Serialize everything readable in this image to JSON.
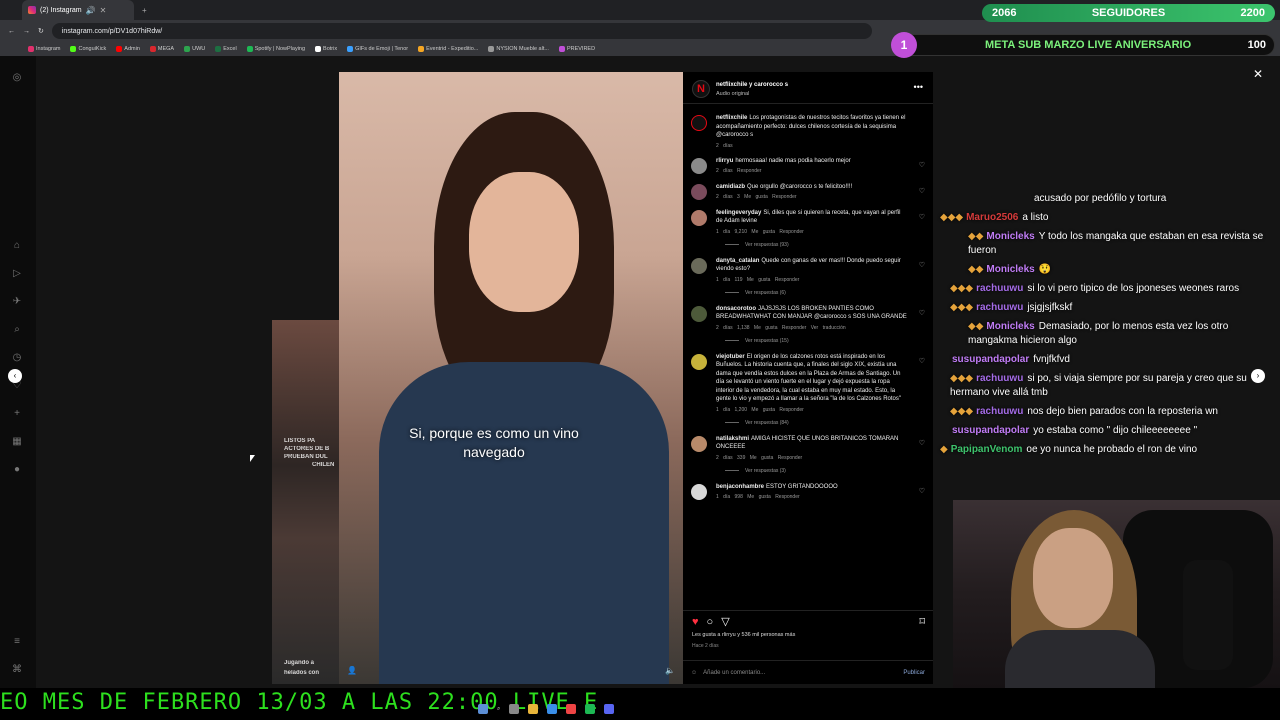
{
  "browser": {
    "tab_title": "(2) Instagram",
    "url": "instagram.com/p/DV1d07hiRdw/",
    "bookmarks": [
      "Instagram",
      "ConguiKick",
      "Admin",
      "MEGA",
      "UWU",
      "Excel",
      "Spotify | NowPlaying",
      "Botrix",
      "GIFs de Emoji | Tenor",
      "Eventrid - Expeditio...",
      "NYSION Mueble alt...",
      "PREVIRED"
    ]
  },
  "stream": {
    "followers_goal": {
      "current": "2066",
      "label": "SEGUIDORES",
      "target": "2200"
    },
    "sub_goal": {
      "badge": "1",
      "label": "META SUB MARZO LIVE ANIVERSARIO",
      "target": "100"
    },
    "ticker": "EO MES DE FEBRERO 13/03 A LAS 22:00 LIVE E"
  },
  "post": {
    "subtitle": "Si, porque es como un vino navegado",
    "author": "netflixchile y carorocco s",
    "audio": "Audio original",
    "thumb_texts": [
      "LISTOS PA",
      "ACTORES DE B",
      "PRUEBAN DUL",
      "CHILEN",
      "Jugando a",
      "helados con"
    ],
    "comments": [
      {
        "user": "netflixchile",
        "text": "Los protagonistas de nuestros tecitos favoritos ya tienen el acompañamiento perfecto: dulces chilenos cortesía de la sequisima @carorocco s",
        "meta": "2 días",
        "replies": ""
      },
      {
        "user": "rlirryu",
        "text": "hermosaaa! nadie mas podia hacerlo mejor",
        "meta": "2 días Responder",
        "replies": ""
      },
      {
        "user": "camidiazb",
        "text": "Que orgullo @carorocco s te felicitoo!!!!",
        "meta": "2 días 3 Me gusta Responder",
        "replies": ""
      },
      {
        "user": "feelingeveryday",
        "text": "Si, diles que si quieren la receta, que vayan al perfil de Adam levine",
        "meta": "1 día 9,210 Me gusta Responder",
        "replies": "Ver respuestas (93)"
      },
      {
        "user": "danyta_catalan",
        "text": "Quede con ganas de ver mas!!! Donde puedo seguir viendo esto?",
        "meta": "1 día 119 Me gusta Responder",
        "replies": "Ver respuestas (6)"
      },
      {
        "user": "donsacorotoo",
        "text": "JAJSJSJS LOS BROKEN PANTIES COMO BREADWHATWHAT CON MANJAR @carorocco s SOS UNA GRANDE",
        "meta": "2 días 1,138 Me gusta Responder Ver traducción",
        "replies": "Ver respuestas (15)"
      },
      {
        "user": "viejotuber",
        "text": "El origen de los calzones rotos está inspirado en los Buñuelos. La historia cuenta que, a finales del siglo XIX, existía una dama que vendía estos dulces en la Plaza de Armas de Santiago. Un día se levantó un viento fuerte en el lugar y dejó expuesta la ropa interior de la vendedora, la cual estaba en muy mal estado. Esto, la gente lo vio y empezó a llamar a la señora \"la de los Calzones Rotos\"",
        "meta": "1 día 1,200 Me gusta Responder",
        "replies": "Ver respuestas (84)"
      },
      {
        "user": "natilakshmi",
        "text": "AMIGA HICISTE QUE UNOS BRITANICOS TOMARAN ONCEEEE",
        "meta": "2 días 339 Me gusta Responder",
        "replies": "Ver respuestas (3)"
      },
      {
        "user": "benjaconhambre",
        "text": "ESTOY GRITANDOOOOO",
        "meta": "1 día 998 Me gusta Responder",
        "replies": ""
      }
    ],
    "likes_text": "Les gusta a rlirryu y 536 mil personas más",
    "date": "Hace 2 días",
    "comment_placeholder": "Añade un comentario...",
    "publish_label": "Publicar"
  },
  "chat": [
    {
      "user": "",
      "message": "acusado por pedófilo y tortura",
      "color": "#ffffff"
    },
    {
      "user": "Maruo2506",
      "message": "a listo",
      "color": "#d63b3b"
    },
    {
      "user": "Monicleks",
      "message": "Y todo los mangaka que estaban en esa revista se fueron",
      "color": "#c07cf5"
    },
    {
      "user": "Monicleks",
      "message": "😲",
      "color": "#c07cf5"
    },
    {
      "user": "rachuuwu",
      "message": "si lo vi pero tipico de los jponeses weones raros",
      "color": "#a56ce8"
    },
    {
      "user": "rachuuwu",
      "message": "jsjgjsjfkskf",
      "color": "#a56ce8"
    },
    {
      "user": "Monicleks",
      "message": "Demasiado, por lo menos esta vez los otro mangakma hicieron algo",
      "color": "#c07cf5"
    },
    {
      "user": "susupandapolar",
      "message": "fvnjfkfvd",
      "color": "#c07cf5"
    },
    {
      "user": "rachuuwu",
      "message": "si po, si viaja siempre por su pareja y creo que su hermano vive allá tmb",
      "color": "#a56ce8"
    },
    {
      "user": "rachuuwu",
      "message": "nos dejo bien parados con la reposteria wn",
      "color": "#a56ce8"
    },
    {
      "user": "susupandapolar",
      "message": "yo estaba como \" dijo chileeeeeeee \"",
      "color": "#c07cf5"
    },
    {
      "user": "PapipanVenom",
      "message": "oe yo nunca he probado el ron de vino",
      "color": "#3ec46d"
    }
  ]
}
